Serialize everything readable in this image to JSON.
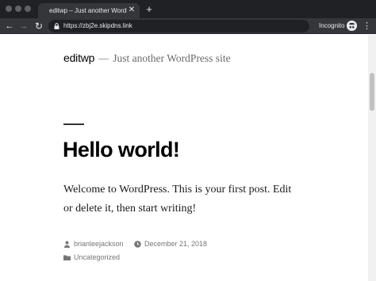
{
  "browser": {
    "tab_title": "editwp – Just another WordPre",
    "tab_close_icon": "close-icon",
    "new_tab_icon": "plus-icon",
    "url": "https://zbj2e.skipdns.link",
    "incognito_label": "Incognito",
    "colors": {
      "frame": "#202124",
      "toolbar": "#35363a",
      "text": "#e8eaed"
    }
  },
  "site": {
    "title": "editwp",
    "separator": "—",
    "description": "Just another WordPress site"
  },
  "post": {
    "title": "Hello world!",
    "content": "Welcome to WordPress. This is your first post. Edit or delete it, then start writing!",
    "author": "brianleejackson",
    "date": "December 21, 2018",
    "category": "Uncategorized"
  }
}
